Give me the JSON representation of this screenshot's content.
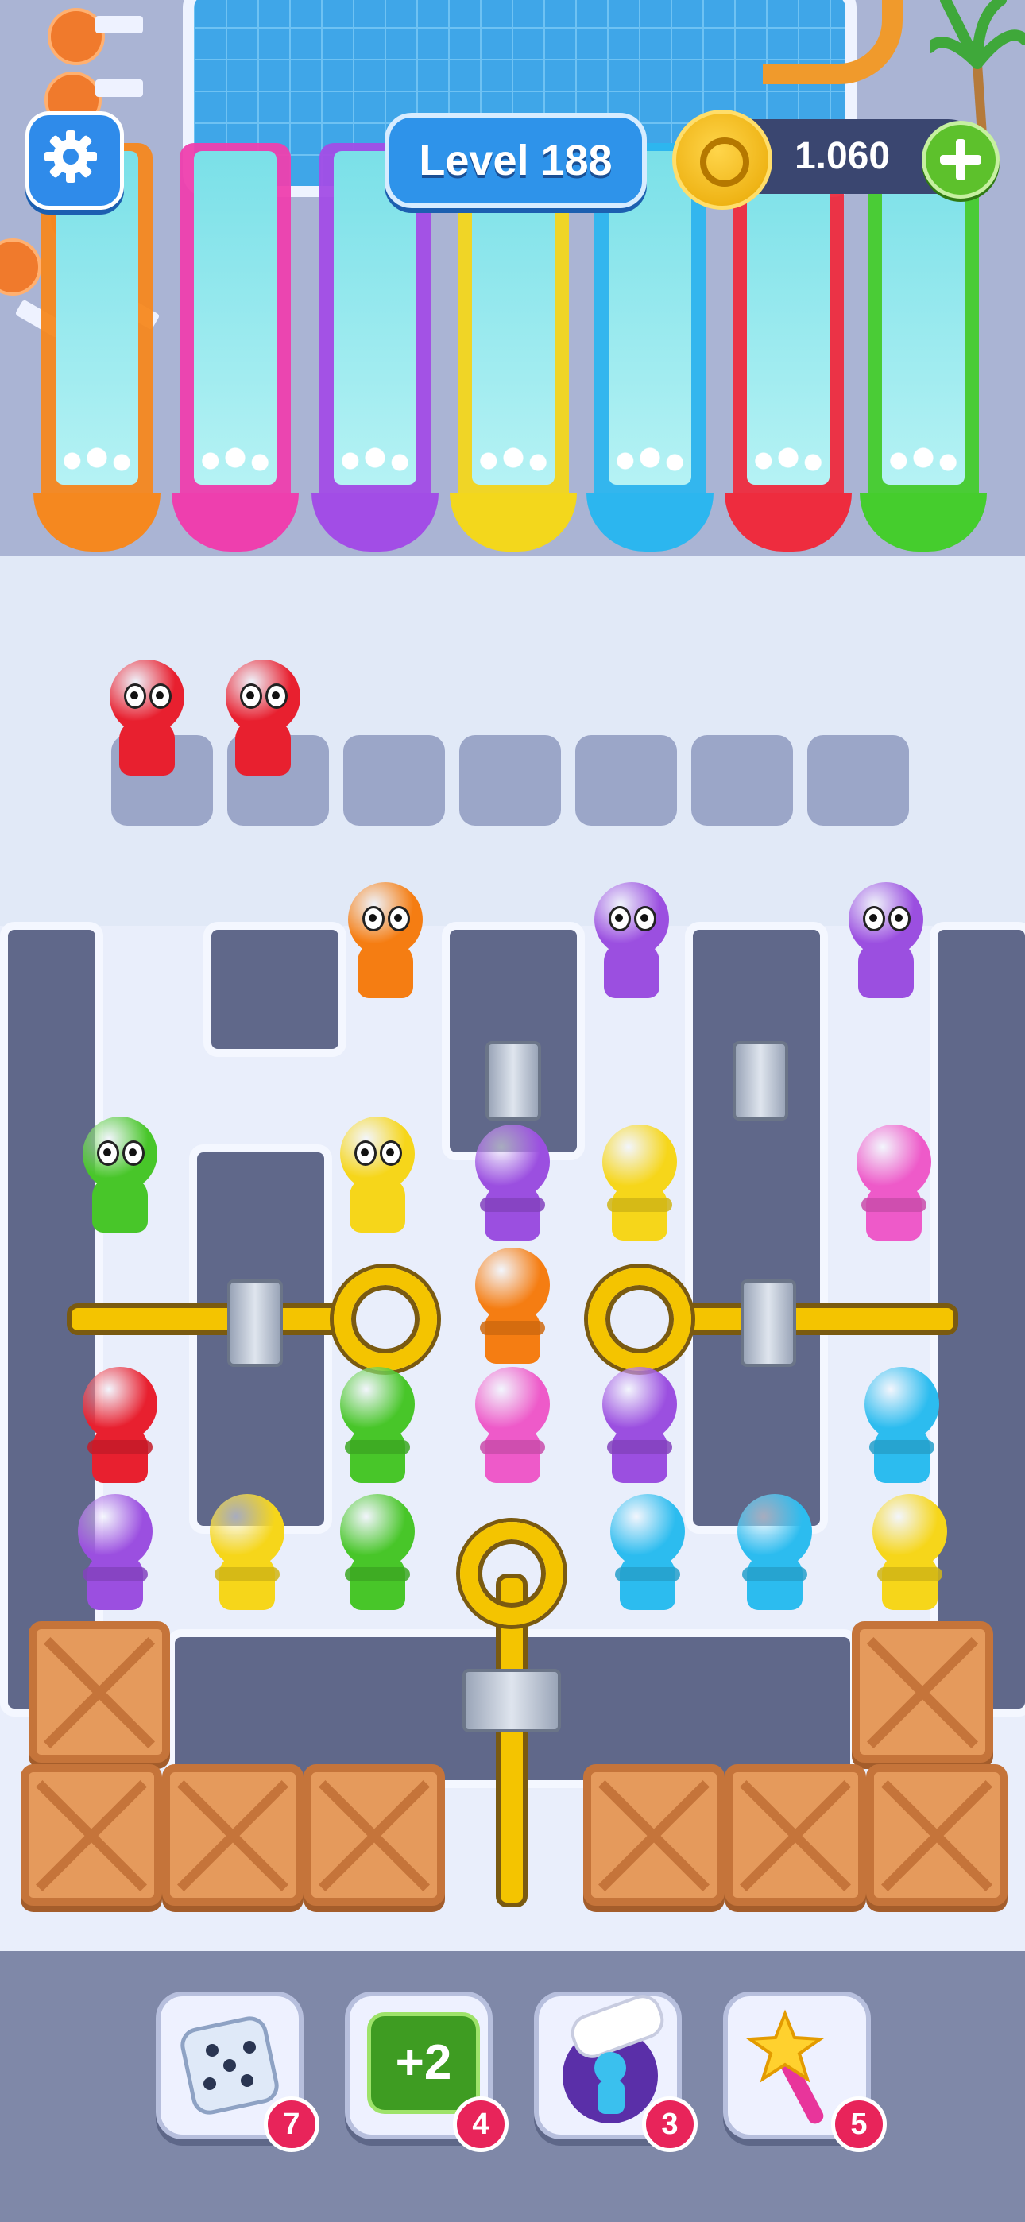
{
  "header": {
    "level_label": "Level 188",
    "coins": "1.060"
  },
  "slides": [
    {
      "color": "#f5881f"
    },
    {
      "color": "#ee3fae"
    },
    {
      "color": "#a24de6"
    },
    {
      "color": "#f3d71c"
    },
    {
      "color": "#2cb6ef"
    },
    {
      "color": "#ee2c3e"
    },
    {
      "color": "#45cd2d"
    }
  ],
  "queue": {
    "slot_count": 7,
    "waiting": [
      "red",
      "red"
    ]
  },
  "board_people": [
    {
      "color": "orange",
      "facing": "front"
    },
    {
      "color": "purple",
      "facing": "front"
    },
    {
      "color": "purple",
      "facing": "front"
    },
    {
      "color": "green",
      "facing": "front"
    },
    {
      "color": "yellow",
      "facing": "front"
    },
    {
      "color": "purple",
      "facing": "back"
    },
    {
      "color": "yellow",
      "facing": "back"
    },
    {
      "color": "pink",
      "facing": "back"
    },
    {
      "color": "orange",
      "facing": "back"
    },
    {
      "color": "red",
      "facing": "back"
    },
    {
      "color": "green",
      "facing": "back"
    },
    {
      "color": "pink",
      "facing": "back"
    },
    {
      "color": "purple",
      "facing": "back"
    },
    {
      "color": "cyan",
      "facing": "back"
    },
    {
      "color": "purple",
      "facing": "back"
    },
    {
      "color": "yellow",
      "facing": "back"
    },
    {
      "color": "green",
      "facing": "back"
    },
    {
      "color": "cyan",
      "facing": "back"
    },
    {
      "color": "cyan",
      "facing": "back"
    },
    {
      "color": "yellow",
      "facing": "back"
    }
  ],
  "powerups": [
    {
      "name": "shuffle-dice",
      "count": "7"
    },
    {
      "name": "plus-two",
      "label": "+2",
      "count": "4"
    },
    {
      "name": "grab-hand",
      "count": "3"
    },
    {
      "name": "magic-wand",
      "count": "5"
    }
  ],
  "colors": {
    "red": "#e8202f",
    "orange": "#f57d12",
    "purple": "#9b4fe0",
    "green": "#48c629",
    "yellow": "#f6d61a",
    "pink": "#ee5ac9",
    "cyan": "#2cbcef"
  }
}
